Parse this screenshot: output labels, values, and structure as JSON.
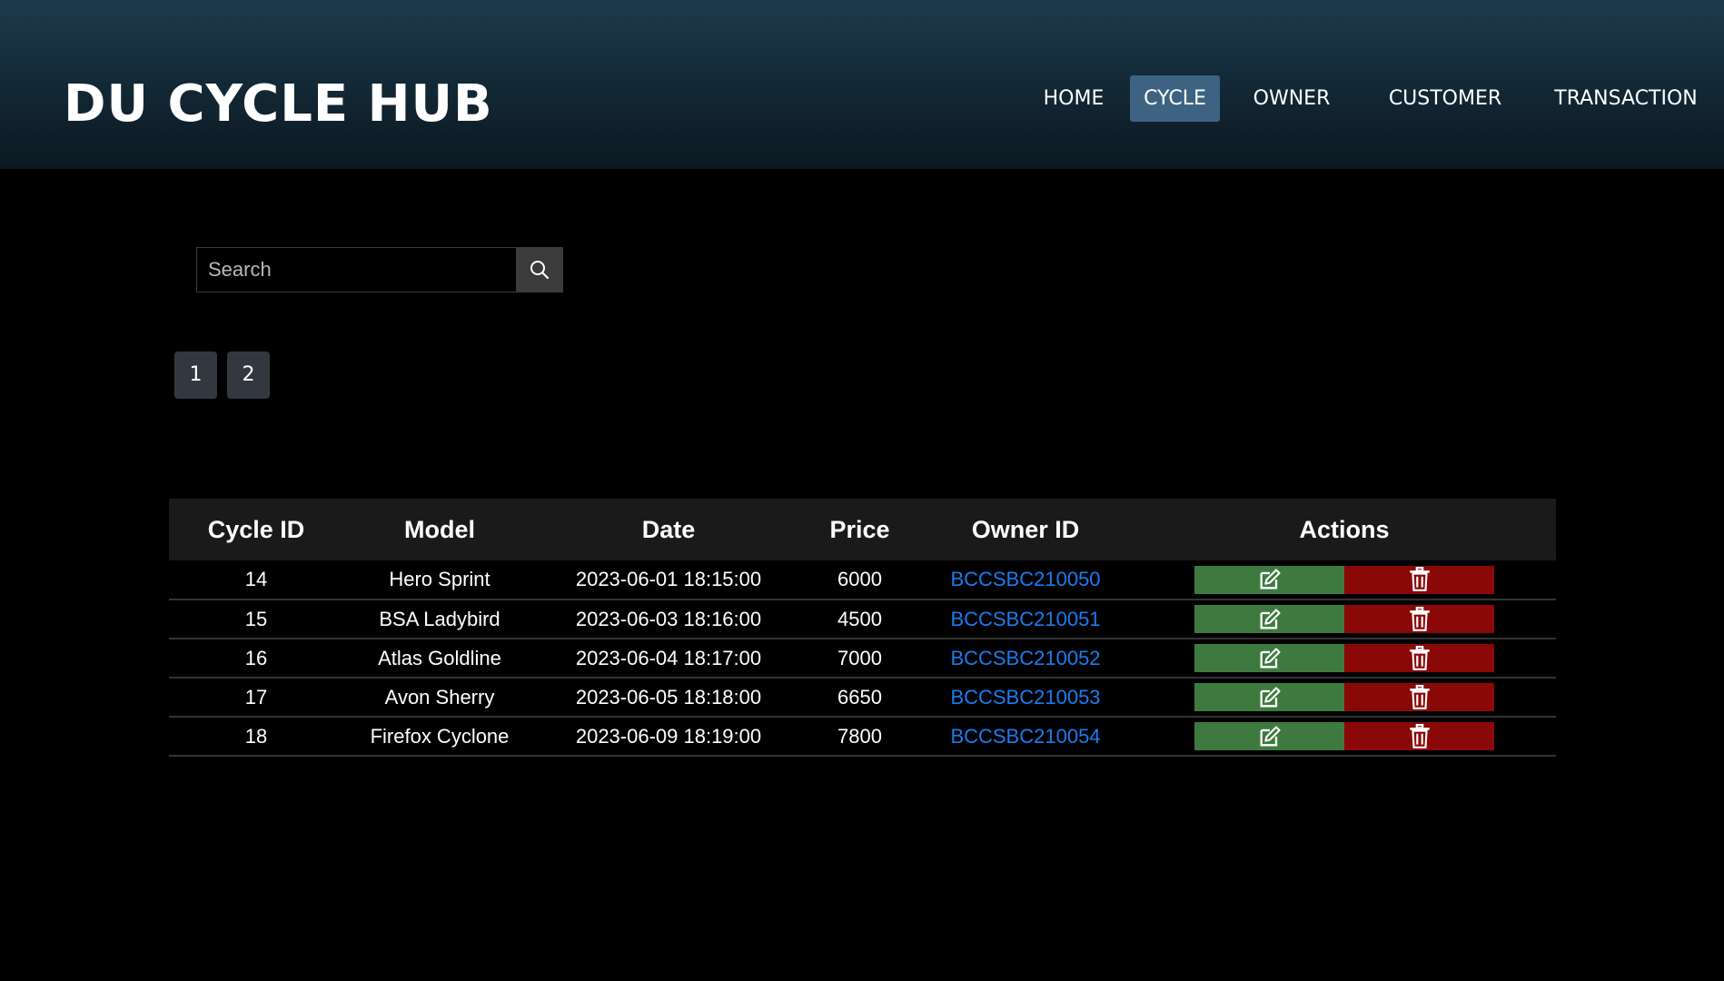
{
  "header": {
    "brand": "DU CYCLE HUB",
    "nav": [
      {
        "label": "HOME",
        "active": false
      },
      {
        "label": "CYCLE",
        "active": true
      },
      {
        "label": "OWNER",
        "active": false
      },
      {
        "label": "CUSTOMER",
        "active": false
      },
      {
        "label": "TRANSACTION",
        "active": false
      }
    ],
    "active_color": "#3e6382"
  },
  "search": {
    "placeholder": "Search",
    "icon": "search-icon"
  },
  "pagination": [
    "1",
    "2"
  ],
  "table": {
    "columns": [
      "Cycle ID",
      "Model",
      "Date",
      "Price",
      "Owner ID",
      "Actions"
    ],
    "rows": [
      {
        "id": "14",
        "model": "Hero Sprint",
        "date": "2023-06-01 18:15:00",
        "price": "6000",
        "owner": "BCCSBC210050"
      },
      {
        "id": "15",
        "model": "BSA Ladybird",
        "date": "2023-06-03 18:16:00",
        "price": "4500",
        "owner": "BCCSBC210051"
      },
      {
        "id": "16",
        "model": "Atlas Goldline",
        "date": "2023-06-04 18:17:00",
        "price": "7000",
        "owner": "BCCSBC210052"
      },
      {
        "id": "17",
        "model": "Avon Sherry",
        "date": "2023-06-05 18:18:00",
        "price": "6650",
        "owner": "BCCSBC210053"
      },
      {
        "id": "18",
        "model": "Firefox Cyclone",
        "date": "2023-06-09 18:19:00",
        "price": "7800",
        "owner": "BCCSBC210054"
      }
    ],
    "edit_icon": "edit-icon",
    "delete_icon": "trash-icon",
    "edit_color": "#3e7a40",
    "delete_color": "#8b0808",
    "link_color": "#1a7cf0"
  }
}
